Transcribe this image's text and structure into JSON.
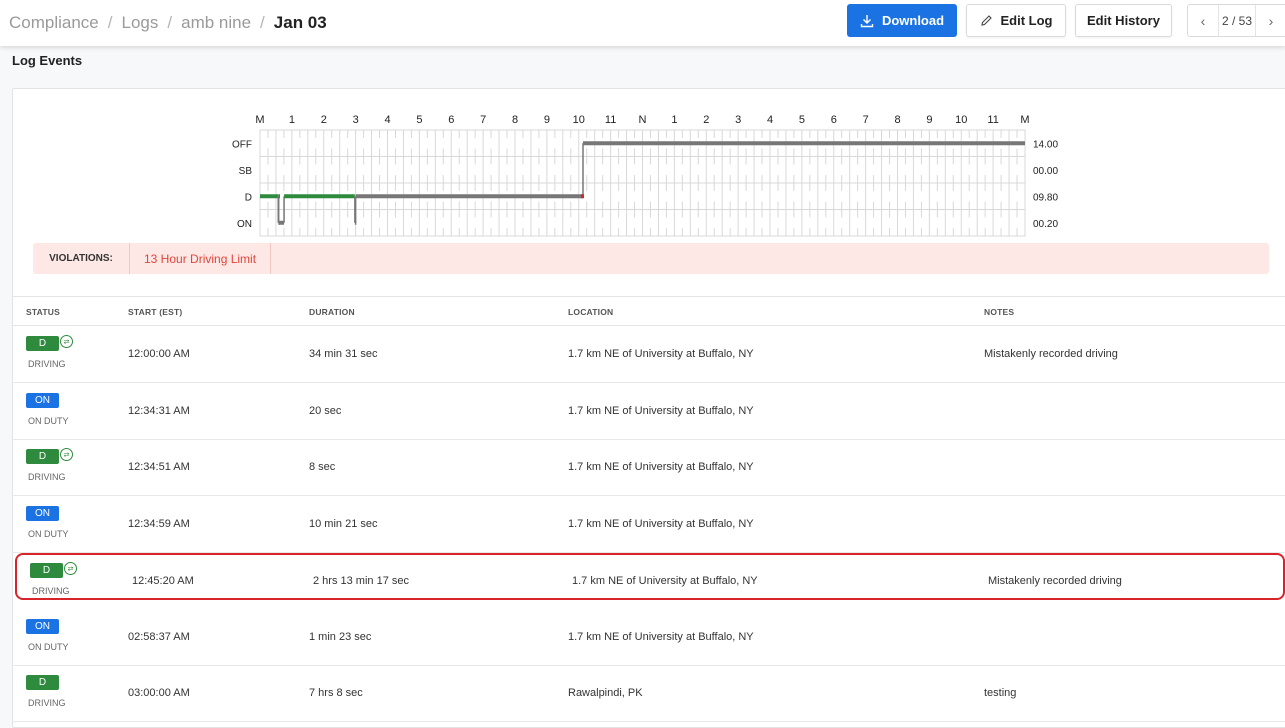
{
  "breadcrumb": {
    "items": [
      "Compliance",
      "Logs",
      "amb nine"
    ],
    "current": "Jan 03"
  },
  "toolbar": {
    "download": "Download",
    "edit_log": "Edit Log",
    "edit_history": "Edit History"
  },
  "pager": {
    "text": "2 / 53"
  },
  "section_title": "Log Events",
  "chart": {
    "hours": [
      "M",
      "1",
      "2",
      "3",
      "4",
      "5",
      "6",
      "7",
      "8",
      "9",
      "10",
      "11",
      "N",
      "1",
      "2",
      "3",
      "4",
      "5",
      "6",
      "7",
      "8",
      "9",
      "10",
      "11",
      "M"
    ],
    "rows": [
      "OFF",
      "SB",
      "D",
      "ON"
    ],
    "totals": [
      "14.00",
      "00.00",
      "09.80",
      "00.20"
    ],
    "colors": {
      "grid": "#d8d8d8",
      "line_gray": "#777777",
      "line_green": "#2e8b3e",
      "violation": "#d9232a"
    }
  },
  "chart_data": {
    "type": "line",
    "x_unit": "hour of day",
    "segments": [
      {
        "status": "D",
        "start": 0.0,
        "end": 0.575,
        "style": "green"
      },
      {
        "status": "ON",
        "start": 0.575,
        "end": 0.581,
        "style": "gray"
      },
      {
        "status": "D",
        "start": 0.581,
        "end": 0.583,
        "style": "green"
      },
      {
        "status": "ON",
        "start": 0.583,
        "end": 0.755,
        "style": "gray"
      },
      {
        "status": "D",
        "start": 0.755,
        "end": 2.976,
        "style": "green"
      },
      {
        "status": "ON",
        "start": 2.976,
        "end": 3.0,
        "style": "gray"
      },
      {
        "status": "D",
        "start": 3.0,
        "end": 10.133,
        "style": "gray"
      },
      {
        "status": "OFF",
        "start": 10.133,
        "end": 24.0,
        "style": "gray"
      }
    ]
  },
  "violations": {
    "label": "VIOLATIONS:",
    "items": [
      "13 Hour Driving Limit"
    ]
  },
  "table": {
    "headers": [
      "STATUS",
      "START (EST)",
      "DURATION",
      "LOCATION",
      "NOTES"
    ],
    "rows": [
      {
        "code": "D",
        "kind": "d",
        "status": "DRIVING",
        "start": "12:00:00 AM",
        "duration": "34 min 31 sec",
        "location": "1.7 km NE of University at Buffalo, NY",
        "notes": "Mistakenly recorded driving",
        "edited": true
      },
      {
        "code": "ON",
        "kind": "on",
        "status": "ON DUTY",
        "start": "12:34:31 AM",
        "duration": "20 sec",
        "location": "1.7 km NE of University at Buffalo, NY",
        "notes": "",
        "edited": false
      },
      {
        "code": "D",
        "kind": "d",
        "status": "DRIVING",
        "start": "12:34:51 AM",
        "duration": "8 sec",
        "location": "1.7 km NE of University at Buffalo, NY",
        "notes": "",
        "edited": true
      },
      {
        "code": "ON",
        "kind": "on",
        "status": "ON DUTY",
        "start": "12:34:59 AM",
        "duration": "10 min 21 sec",
        "location": "1.7 km NE of University at Buffalo, NY",
        "notes": "",
        "edited": false
      },
      {
        "code": "D",
        "kind": "d",
        "status": "DRIVING",
        "start": "12:45:20 AM",
        "duration": "2 hrs 13 min 17 sec",
        "location": "1.7 km NE of University at Buffalo, NY",
        "notes": "Mistakenly recorded driving",
        "edited": true,
        "highlight": true
      },
      {
        "code": "ON",
        "kind": "on",
        "status": "ON DUTY",
        "start": "02:58:37 AM",
        "duration": "1 min 23 sec",
        "location": "1.7 km NE of University at Buffalo, NY",
        "notes": "",
        "edited": false
      },
      {
        "code": "D",
        "kind": "d",
        "status": "DRIVING",
        "start": "03:00:00 AM",
        "duration": "7 hrs 8 sec",
        "location": "Rawalpindi, PK",
        "notes": "testing",
        "edited": false
      }
    ]
  }
}
